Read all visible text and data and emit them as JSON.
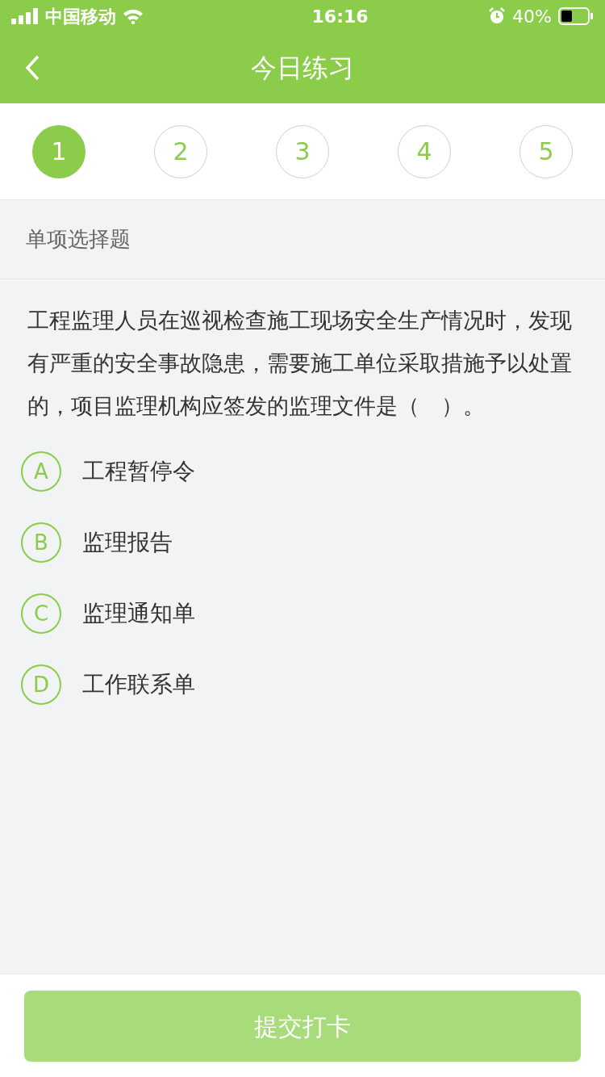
{
  "status_bar": {
    "carrier": "中国移动",
    "time": "16:16",
    "battery": "40%"
  },
  "nav_bar": {
    "title": "今日练习"
  },
  "steps": [
    {
      "label": "1",
      "selected": true
    },
    {
      "label": "2",
      "selected": false
    },
    {
      "label": "3",
      "selected": false
    },
    {
      "label": "4",
      "selected": false
    },
    {
      "label": "5",
      "selected": false
    }
  ],
  "question_type": "单项选择题",
  "question": "工程监理人员在巡视检查施工现场安全生产情况时，发现有严重的安全事故隐患，需要施工单位采取措施予以处置的，项目监理机构应签发的监理文件是（　）。",
  "options": [
    {
      "letter": "A",
      "text": "工程暂停令",
      "selected": false
    },
    {
      "letter": "B",
      "text": "监理报告",
      "selected": false
    },
    {
      "letter": "C",
      "text": "监理通知单",
      "selected": false
    },
    {
      "letter": "D",
      "text": "工作联系单",
      "selected": false
    }
  ],
  "submit_button": {
    "label": "提交打卡",
    "disabled": true
  }
}
